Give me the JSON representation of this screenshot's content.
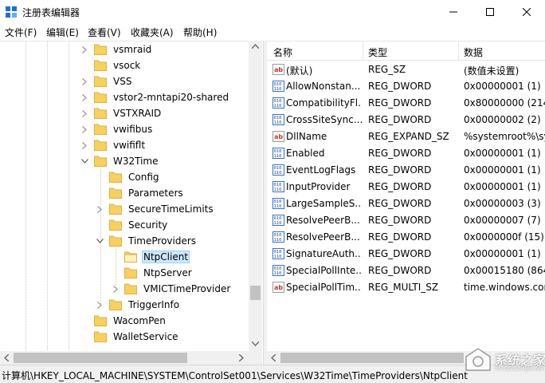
{
  "window": {
    "title": "注册表编辑器"
  },
  "menu": [
    "文件(F)",
    "编辑(E)",
    "查看(V)",
    "收藏夹(A)",
    "帮助(H)"
  ],
  "tree": [
    {
      "label": "vsmraid",
      "depth": 0,
      "expander": "collapsed"
    },
    {
      "label": "vsock",
      "depth": 0,
      "expander": "none"
    },
    {
      "label": "VSS",
      "depth": 0,
      "expander": "collapsed"
    },
    {
      "label": "vstor2-mntapi20-shared",
      "depth": 0,
      "expander": "collapsed"
    },
    {
      "label": "VSTXRAID",
      "depth": 0,
      "expander": "collapsed"
    },
    {
      "label": "vwifibus",
      "depth": 0,
      "expander": "collapsed"
    },
    {
      "label": "vwififlt",
      "depth": 0,
      "expander": "collapsed"
    },
    {
      "label": "W32Time",
      "depth": 0,
      "expander": "expanded"
    },
    {
      "label": "Config",
      "depth": 1,
      "expander": "none"
    },
    {
      "label": "Parameters",
      "depth": 1,
      "expander": "none"
    },
    {
      "label": "SecureTimeLimits",
      "depth": 1,
      "expander": "collapsed"
    },
    {
      "label": "Security",
      "depth": 1,
      "expander": "none"
    },
    {
      "label": "TimeProviders",
      "depth": 1,
      "expander": "expanded"
    },
    {
      "label": "NtpClient",
      "depth": 2,
      "expander": "none",
      "selected": true
    },
    {
      "label": "NtpServer",
      "depth": 2,
      "expander": "none"
    },
    {
      "label": "VMICTimeProvider",
      "depth": 2,
      "expander": "collapsed"
    },
    {
      "label": "TriggerInfo",
      "depth": 1,
      "expander": "collapsed"
    },
    {
      "label": "WacomPen",
      "depth": 0,
      "expander": "none"
    },
    {
      "label": "WalletService",
      "depth": 0,
      "expander": "none"
    }
  ],
  "columns": {
    "name": "名称",
    "type": "类型",
    "data": "数据"
  },
  "values": [
    {
      "name": "(默认)",
      "type": "REG_SZ",
      "data": "(数值未设置)",
      "icon": "string-value-icon"
    },
    {
      "name": "AllowNonstan...",
      "type": "REG_DWORD",
      "data": "0x00000001 (1)",
      "icon": "binary-value-icon"
    },
    {
      "name": "CompatibilityFl...",
      "type": "REG_DWORD",
      "data": "0x80000000 (2147",
      "icon": "binary-value-icon"
    },
    {
      "name": "CrossSiteSync...",
      "type": "REG_DWORD",
      "data": "0x00000002 (2)",
      "icon": "binary-value-icon"
    },
    {
      "name": "DllName",
      "type": "REG_EXPAND_SZ",
      "data": "%systemroot%\\sy",
      "icon": "string-value-icon"
    },
    {
      "name": "Enabled",
      "type": "REG_DWORD",
      "data": "0x00000001 (1)",
      "icon": "binary-value-icon"
    },
    {
      "name": "EventLogFlags",
      "type": "REG_DWORD",
      "data": "0x00000001 (1)",
      "icon": "binary-value-icon"
    },
    {
      "name": "InputProvider",
      "type": "REG_DWORD",
      "data": "0x00000001 (1)",
      "icon": "binary-value-icon"
    },
    {
      "name": "LargeSampleS...",
      "type": "REG_DWORD",
      "data": "0x00000003 (3)",
      "icon": "binary-value-icon"
    },
    {
      "name": "ResolvePeerB...",
      "type": "REG_DWORD",
      "data": "0x00000007 (7)",
      "icon": "binary-value-icon"
    },
    {
      "name": "ResolvePeerB...",
      "type": "REG_DWORD",
      "data": "0x0000000f (15)",
      "icon": "binary-value-icon"
    },
    {
      "name": "SignatureAuth...",
      "type": "REG_DWORD",
      "data": "0x00000001 (1)",
      "icon": "binary-value-icon"
    },
    {
      "name": "SpecialPollInte...",
      "type": "REG_DWORD",
      "data": "0x00015180 (8640",
      "icon": "binary-value-icon"
    },
    {
      "name": "SpecialPollTim...",
      "type": "REG_MULTI_SZ",
      "data": "time.windows.com",
      "icon": "string-value-icon"
    }
  ],
  "status": {
    "path": "计算机\\HKEY_LOCAL_MACHINE\\SYSTEM\\ControlSet001\\Services\\W32Time\\TimeProviders\\NtpClient"
  },
  "watermark": {
    "text": "系统之家",
    "sub": "XITONGZHIJIA.NET"
  },
  "colors": {
    "folder": "#f7d062",
    "folder_dark": "#e0b040",
    "selection": "#cce8ff",
    "accent": "#1e6fd9"
  }
}
